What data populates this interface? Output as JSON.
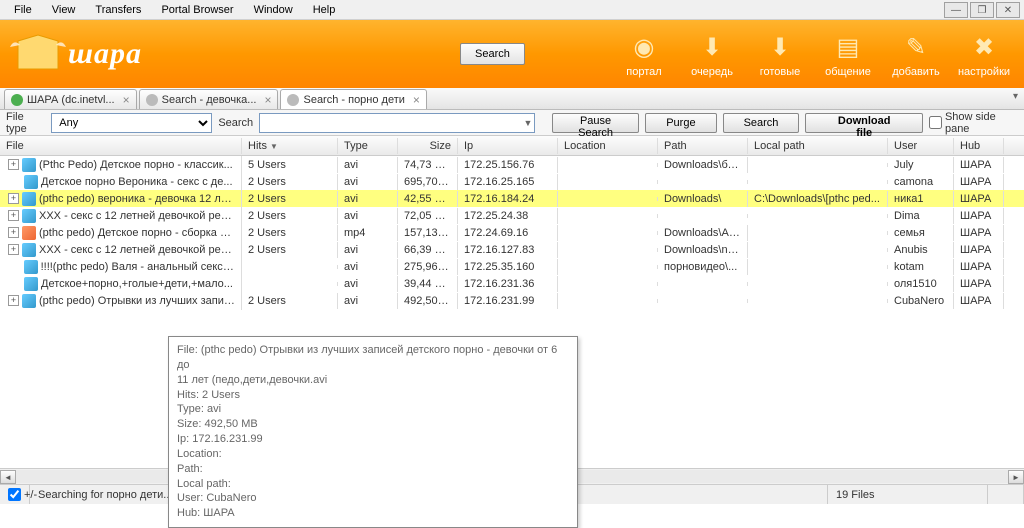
{
  "menu": [
    "File",
    "View",
    "Transfers",
    "Portal Browser",
    "Window",
    "Help"
  ],
  "app_logo": "шара",
  "main_search_btn": "Search",
  "toolbar_buttons": [
    {
      "label": "портал",
      "icon": "◉"
    },
    {
      "label": "очередь",
      "icon": "⬇"
    },
    {
      "label": "готовые",
      "icon": "⬇"
    },
    {
      "label": "общение",
      "icon": "▤"
    },
    {
      "label": "добавить",
      "icon": "✎"
    },
    {
      "label": "настройки",
      "icon": "✖"
    }
  ],
  "tabs": [
    {
      "label": "ШАРА (dc.inetvl...",
      "color": "#4caf50",
      "active": false
    },
    {
      "label": "Search - девочка...",
      "color": "#bbb",
      "active": false
    },
    {
      "label": "Search - порно дети",
      "color": "#bbb",
      "active": true
    }
  ],
  "searchbar": {
    "filetype_label": "File type",
    "filetype_value": "Any",
    "search_label": "Search",
    "search_value": "",
    "pause_btn": "Pause Search",
    "purge_btn": "Purge",
    "search_btn": "Search",
    "download_btn": "Download file",
    "side_pane_label": "Show side pane",
    "side_pane_checked": false
  },
  "columns": [
    "File",
    "Hits",
    "Type",
    "Size",
    "Ip",
    "Location",
    "Path",
    "Local path",
    "User",
    "Hub"
  ],
  "rows": [
    {
      "exp": true,
      "file": "(Pthc Pedo) Детское порно - классик...",
      "hits": "5 Users",
      "type": "avi",
      "size": "74,73 MB",
      "ip": "172.25.156.76",
      "loc": "",
      "path": "Downloads\\бу...",
      "lpath": "",
      "user": "July",
      "hub": "ШАРА"
    },
    {
      "exp": false,
      "file": "Детское порно Вероника - секс с де...",
      "hits": "2 Users",
      "type": "avi",
      "size": "695,70 MB",
      "ip": "172.16.25.165",
      "loc": "",
      "path": "",
      "lpath": "",
      "user": "camona",
      "hub": "ШАРА"
    },
    {
      "exp": true,
      "hl": true,
      "file": "(pthc pedo) вероника - девочка 12 лет...",
      "hits": "2 Users",
      "type": "avi",
      "size": "42,55 MB",
      "ip": "172.16.184.24",
      "loc": "",
      "path": "Downloads\\",
      "lpath": "C:\\Downloads\\[pthc ped...",
      "user": "ника1",
      "hub": "ШАРА"
    },
    {
      "exp": true,
      "file": "XXX - секс с 12 летней девочкой ped...",
      "hits": "2 Users",
      "type": "avi",
      "size": "72,05 MB",
      "ip": "172.25.24.38",
      "loc": "",
      "path": "",
      "lpath": "",
      "user": "Dima",
      "hub": "ШАРА"
    },
    {
      "exp": true,
      "file": "(pthc pedo) Детское порно - сборка и...",
      "hits": "2 Users",
      "type": "mp4",
      "size": "157,13 MB",
      "ip": "172.24.69.16",
      "loc": "",
      "path": "Downloads\\Ap...",
      "lpath": "",
      "user": "семья",
      "hub": "ШАРА"
    },
    {
      "exp": true,
      "file": "XXX - секс с 12 летней девочкой ped...",
      "hits": "2 Users",
      "type": "avi",
      "size": "66,39 MB",
      "ip": "172.16.127.83",
      "loc": "",
      "path": "Downloads\\no...",
      "lpath": "",
      "user": "Anubis",
      "hub": "ШАРА"
    },
    {
      "exp": false,
      "file": "!!!!(pthc pedo) Валя - анальный секс с...",
      "hits": "",
      "type": "avi",
      "size": "275,96 MB",
      "ip": "172.25.35.160",
      "loc": "",
      "path": "порновидео\\...",
      "lpath": "",
      "user": "kotam",
      "hub": "ШАРА"
    },
    {
      "exp": false,
      "file": "Детское+порно,+голые+дети,+мало...",
      "hits": "",
      "type": "avi",
      "size": "39,44 MB",
      "ip": "172.16.231.36",
      "loc": "",
      "path": "",
      "lpath": "",
      "user": "оля1510",
      "hub": "ШАРА"
    },
    {
      "exp": true,
      "file": "(pthc pedo) Отрывки из лучших запис...",
      "hits": "2 Users",
      "type": "avi",
      "size": "492,50 MB",
      "ip": "172.16.231.99",
      "loc": "",
      "path": "",
      "lpath": "",
      "user": "CubaNero",
      "hub": "ШАРА"
    }
  ],
  "tooltip": {
    "l1": "File: (pthc pedo) Отрывки из лучших записей детского порно - девочки от 6 до",
    "l2": "11 лет (педо,дети,девочки.avi",
    "l3": "Hits: 2 Users",
    "l4": "Type: avi",
    "l5": "Size: 492,50 MB",
    "l6": "Ip: 172.16.231.99",
    "l7": "Location:",
    "l8": "Path:",
    "l9": "Local path:",
    "l10": "User: CubaNero",
    "l11": "Hub: ШАРА"
  },
  "status": {
    "toggle": "+/-",
    "text": "Searching for порно дети...",
    "files": "19 Files"
  }
}
